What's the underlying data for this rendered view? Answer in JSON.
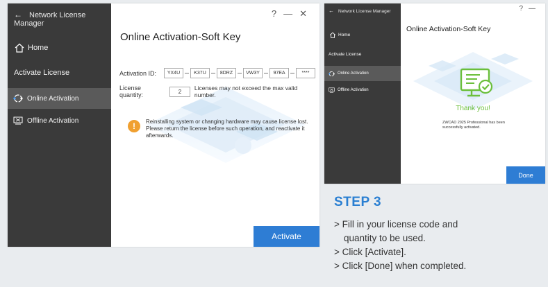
{
  "left_window": {
    "app_title": "Network License Manager",
    "window_controls": [
      "?",
      "—",
      "✕"
    ],
    "sidebar": {
      "home_label": "Home",
      "section_label": "Activate License",
      "items": [
        {
          "label": "Online Activation",
          "active": true
        },
        {
          "label": "Offline Activation",
          "active": false
        }
      ]
    },
    "heading": "Online Activation-Soft Key",
    "activation_id_label": "Activation ID:",
    "key_parts": [
      "YX4U",
      "K37U",
      "8DRZ",
      "VW3Y",
      "97EA",
      "****"
    ],
    "quantity_label": "License quantity:",
    "quantity_value": "2",
    "quantity_note": "Licenses may not exceed the max valid number.",
    "warning_text": "Reinstalling system or changing hardware may cause license lost. Please return the license before such operation, and reactivate it afterwards.",
    "activate_button": "Activate"
  },
  "right_window": {
    "app_title": "Network License Manager",
    "window_controls": [
      "?",
      "—"
    ],
    "sidebar": {
      "home_label": "Home",
      "section_label": "Activate License",
      "items": [
        {
          "label": "Online Activation",
          "active": true
        },
        {
          "label": "Offline Activation",
          "active": false
        }
      ]
    },
    "heading": "Online Activation-Soft Key",
    "thanks_text": "Thank you!",
    "success_message": "ZWCAD 2025 Professional has been successfully activated.",
    "done_button": "Done"
  },
  "step": {
    "title": "STEP 3",
    "lines": [
      "> Fill in your license code and",
      "quantity to be used.",
      "> Click [Activate].",
      "> Click [Done] when completed."
    ]
  },
  "colors": {
    "accent": "#2e7dd4",
    "sidebar": "#3a3a3a",
    "sidebar_active": "#5a5a5a",
    "warning": "#f0a030",
    "success": "#6bbf3b"
  }
}
